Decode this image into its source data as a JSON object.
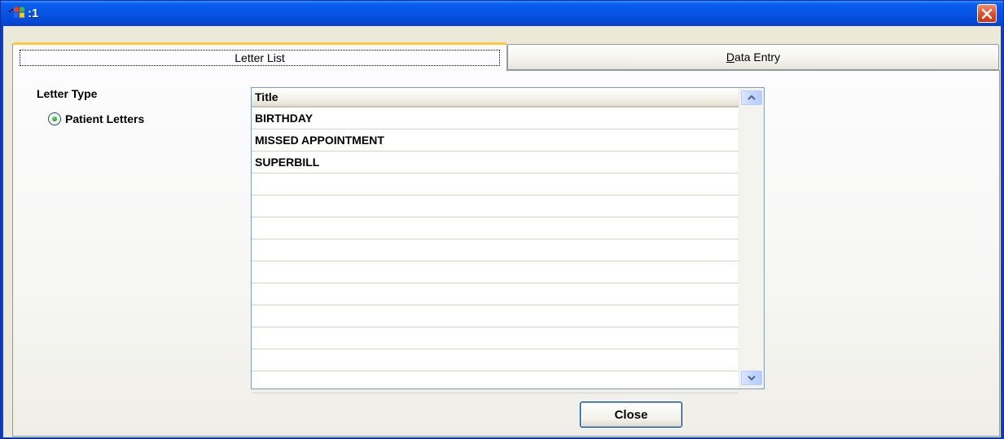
{
  "window": {
    "title": ":1",
    "app_icon": "windows-flag-icon",
    "close_icon": "close-icon"
  },
  "tabs": [
    {
      "label": "Letter List",
      "active": true
    },
    {
      "label_accel": "D",
      "label_rest": "ata Entry",
      "active": false
    }
  ],
  "letter_type": {
    "heading": "Letter Type",
    "option_label": "Patient Letters",
    "selected": true
  },
  "grid": {
    "column_header": "Title",
    "rows": [
      "BIRTHDAY",
      "MISSED APPOINTMENT",
      "SUPERBILL",
      "",
      "",
      "",
      "",
      "",
      "",
      "",
      "",
      "",
      ""
    ]
  },
  "buttons": {
    "close_label": "Close"
  },
  "colors": {
    "titlebar": "#0a5ff0",
    "tab_highlight": "#ffc83c",
    "close_red": "#e0502c"
  }
}
